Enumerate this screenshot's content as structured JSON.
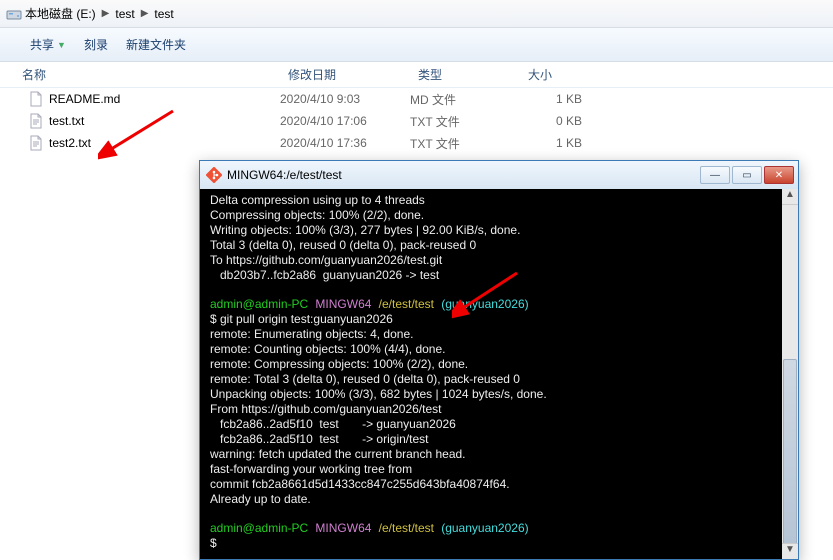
{
  "address": {
    "drive": "本地磁盘 (E:)",
    "seg1": "test",
    "seg2": "test"
  },
  "toolbar": {
    "share": "共享",
    "burn": "刻录",
    "newfolder": "新建文件夹"
  },
  "columns": {
    "name": "名称",
    "date": "修改日期",
    "type": "类型",
    "size": "大小"
  },
  "files": [
    {
      "name": "README.md",
      "date": "2020/4/10 9:03",
      "type": "MD 文件",
      "size": "1 KB"
    },
    {
      "name": "test.txt",
      "date": "2020/4/10 17:06",
      "type": "TXT 文件",
      "size": "0 KB"
    },
    {
      "name": "test2.txt",
      "date": "2020/4/10 17:36",
      "type": "TXT 文件",
      "size": "1 KB"
    }
  ],
  "terminal": {
    "title": "MINGW64:/e/test/test",
    "lines": {
      "l1": "Delta compression using up to 4 threads",
      "l2": "Compressing objects: 100% (2/2), done.",
      "l3": "Writing objects: 100% (3/3), 277 bytes | 92.00 KiB/s, done.",
      "l4": "Total 3 (delta 0), reused 0 (delta 0), pack-reused 0",
      "l5": "To https://github.com/guanyuan2026/test.git",
      "l6": "   db203b7..fcb2a86  guanyuan2026 -> test",
      "p1user": "admin@admin-PC",
      "p1host": "MINGW64",
      "p1path": "/e/test/test",
      "p1branch": "(guanyuan2026)",
      "cmd": "$ git pull origin test:guanyuan2026",
      "r1": "remote: Enumerating objects: 4, done.",
      "r2": "remote: Counting objects: 100% (4/4), done.",
      "r3": "remote: Compressing objects: 100% (2/2), done.",
      "r4": "remote: Total 3 (delta 0), reused 0 (delta 0), pack-reused 0",
      "r5": "Unpacking objects: 100% (3/3), 682 bytes | 1024 bytes/s, done.",
      "r6": "From https://github.com/guanyuan2026/test",
      "r7": "   fcb2a86..2ad5f10  test       -> guanyuan2026",
      "r8": "   fcb2a86..2ad5f10  test       -> origin/test",
      "r9": "warning: fetch updated the current branch head.",
      "r10": "fast-forwarding your working tree from",
      "r11": "commit fcb2a8661d5d1433cc847c255d643bfa40874f64.",
      "r12": "Already up to date.",
      "p2user": "admin@admin-PC",
      "p2host": "MINGW64",
      "p2path": "/e/test/test",
      "p2branch": "(guanyuan2026)",
      "dollar": "$"
    }
  }
}
